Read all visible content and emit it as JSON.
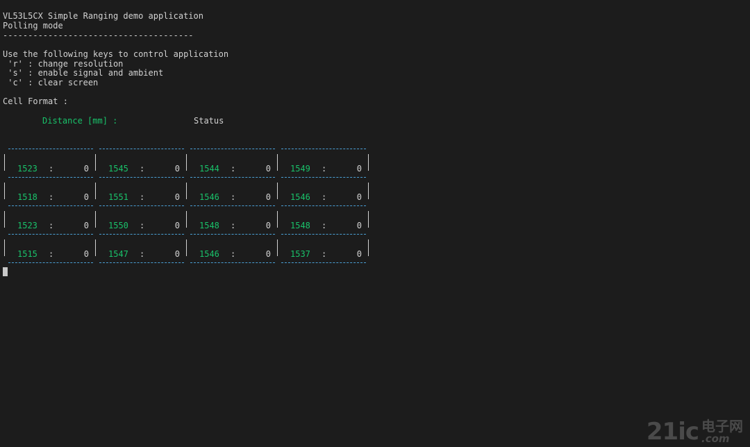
{
  "terminal": {
    "title": "VL53L5CX Simple Ranging demo application",
    "mode": "Polling mode",
    "separator": "--------------------------------------",
    "instructions": "Use the following keys to control application",
    "keys": [
      " 'r' : change resolution",
      " 's' : enable signal and ambient",
      " 'c' : clear screen"
    ],
    "cell_format_label": "Cell Format :",
    "header_distance": "Distance [mm] :",
    "header_status": "Status"
  },
  "grid": {
    "rows": [
      [
        {
          "distance": "1523",
          "status": "0"
        },
        {
          "distance": "1545",
          "status": "0"
        },
        {
          "distance": "1544",
          "status": "0"
        },
        {
          "distance": "1549",
          "status": "0"
        }
      ],
      [
        {
          "distance": "1518",
          "status": "0"
        },
        {
          "distance": "1551",
          "status": "0"
        },
        {
          "distance": "1546",
          "status": "0"
        },
        {
          "distance": "1546",
          "status": "0"
        }
      ],
      [
        {
          "distance": "1523",
          "status": "0"
        },
        {
          "distance": "1550",
          "status": "0"
        },
        {
          "distance": "1548",
          "status": "0"
        },
        {
          "distance": "1548",
          "status": "0"
        }
      ],
      [
        {
          "distance": "1515",
          "status": "0"
        },
        {
          "distance": "1547",
          "status": "0"
        },
        {
          "distance": "1546",
          "status": "0"
        },
        {
          "distance": "1537",
          "status": "0"
        }
      ]
    ]
  },
  "colors": {
    "background": "#1c1c1c",
    "text": "#d2d2d2",
    "distance": "#19c26a",
    "dashes": "#4a9fd4"
  },
  "watermark": {
    "logo": "21ic",
    "cn_text": "电子网",
    "domain": ".com"
  }
}
